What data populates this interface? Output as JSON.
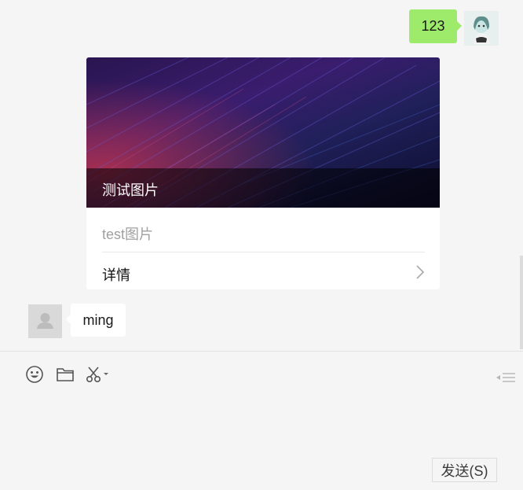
{
  "messages": {
    "outgoing_text": "123",
    "card": {
      "image_caption": "测试图片",
      "description": "test图片",
      "link_label": "详情"
    },
    "incoming_text": "ming"
  },
  "toolbar": {
    "icons": [
      "emoji-icon",
      "folder-icon",
      "scissors-icon",
      "history-icon"
    ]
  },
  "input": {
    "send_label": "发送(S)"
  },
  "colors": {
    "outgoing_bubble": "#9eea6a",
    "background": "#f5f5f5"
  }
}
